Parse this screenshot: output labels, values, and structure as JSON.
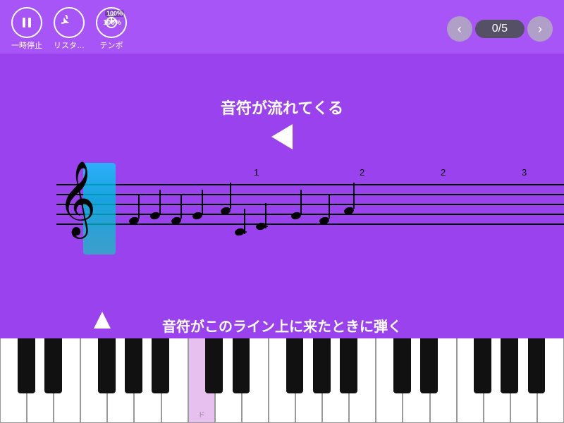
{
  "toolbar": {
    "pause_label": "一時停止",
    "restart_label": "リスタ…",
    "tempo_label": "テンポ",
    "tempo_value": "100%",
    "nav_counter": "0/5"
  },
  "main": {
    "annotation_flow": "音符が流れてくる",
    "annotation_bottom": "音符がこのライン上に来たときに弾く",
    "beat_numbers": [
      "1",
      "2",
      "2",
      "3"
    ],
    "do_label": "ド"
  },
  "icons": {
    "pause": "⏸",
    "restart": "↺",
    "tempo": "⏱",
    "nav_prev": "‹",
    "nav_next": "›"
  }
}
